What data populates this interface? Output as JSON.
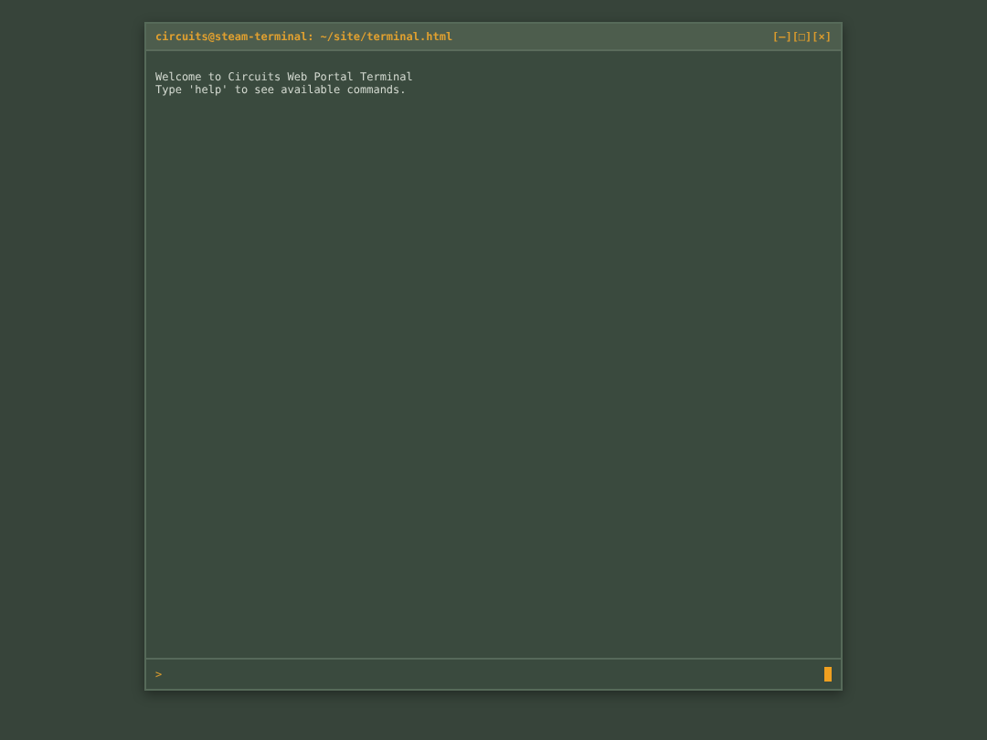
{
  "window": {
    "title": "circuits@steam-terminal: ~/site/terminal.html",
    "controls": [
      "[–]",
      "[□]",
      "[×]"
    ]
  },
  "output_lines": [
    "Welcome to Circuits Web Portal Terminal",
    "Type 'help' to see available commands."
  ],
  "input": {
    "prompt": ">"
  }
}
